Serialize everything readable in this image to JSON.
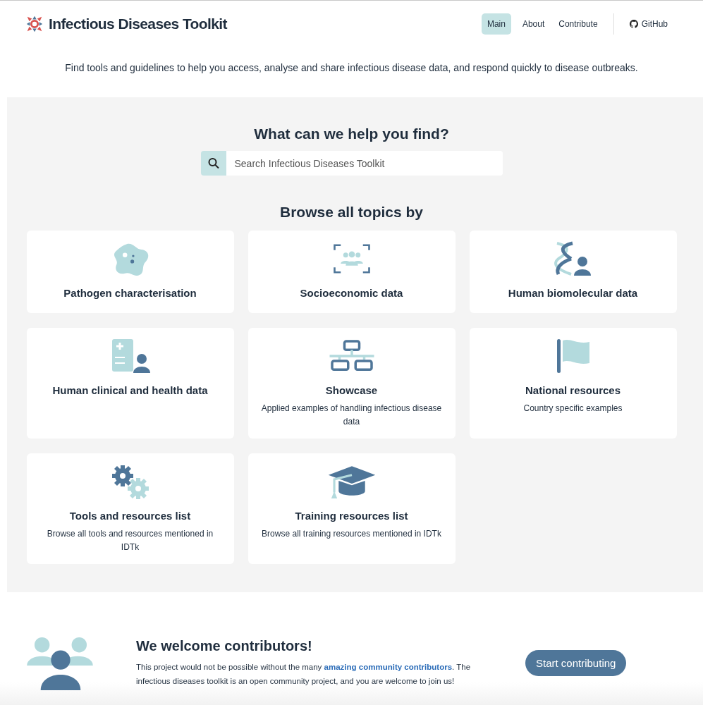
{
  "header": {
    "title": "Infectious Diseases Toolkit",
    "nav": [
      {
        "label": "Main",
        "selected": true
      },
      {
        "label": "About",
        "selected": false
      },
      {
        "label": "Contribute",
        "selected": false
      }
    ],
    "github": "GitHub"
  },
  "tagline": "Find tools and guidelines to help you access, analyse and share infectious disease data, and respond quickly to disease outbreaks.",
  "search": {
    "heading": "What can we help you find?",
    "placeholder": "Search Infectious Diseases Toolkit"
  },
  "browse": {
    "heading": "Browse all topics by",
    "cards": [
      {
        "title": "Pathogen characterisation"
      },
      {
        "title": "Socioeconomic data"
      },
      {
        "title": "Human biomolecular data"
      },
      {
        "title": "Human clinical and health data"
      },
      {
        "title": "Showcase",
        "description": "Applied examples of handling infectious disease data"
      },
      {
        "title": "National resources",
        "description": "Country specific examples"
      },
      {
        "title": "Tools and resources list",
        "description": "Browse all tools and resources mentioned in IDTk"
      },
      {
        "title": "Training resources list",
        "description": "Browse all training resources mentioned in IDTk"
      }
    ]
  },
  "contributors": {
    "heading": "We welcome contributors!",
    "text_before": "This project would not be possible without the many",
    "link": "amazing community contributors",
    "text_after": ". The infectious diseases toolkit is an open community project, and you are welcome to join us!",
    "button": "Start contributing"
  }
}
